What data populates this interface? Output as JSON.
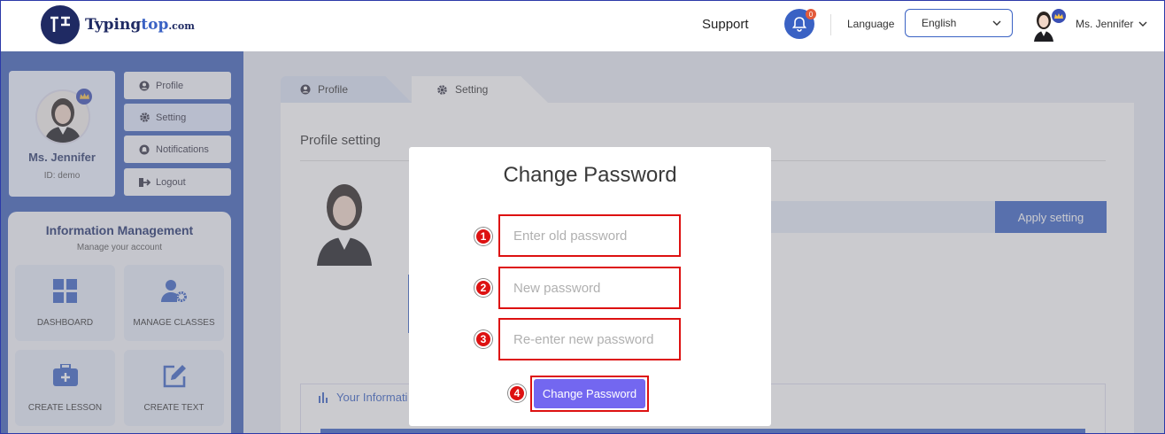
{
  "header": {
    "logo_main": "Typing",
    "logo_accent": "top",
    "logo_suffix": ".com",
    "support": "Support",
    "notification_count": "0",
    "language_label": "Language",
    "language_value": "English",
    "user_name": "Ms. Jennifer"
  },
  "sidebar": {
    "profile_name": "Ms. Jennifer",
    "profile_id": "ID: demo",
    "menu": [
      {
        "label": "Profile",
        "icon": "user-circle-icon"
      },
      {
        "label": "Setting",
        "icon": "gear-icon"
      },
      {
        "label": "Notifications",
        "icon": "bell-icon"
      },
      {
        "label": "Logout",
        "icon": "logout-icon"
      }
    ],
    "info_title": "Information Management",
    "info_subtitle": "Manage your account",
    "tiles": [
      {
        "label": "DASHBOARD",
        "icon": "grid-icon"
      },
      {
        "label": "MANAGE CLASSES",
        "icon": "user-gear-icon"
      },
      {
        "label": "CREATE LESSON",
        "icon": "briefcase-plus-icon"
      },
      {
        "label": "CREATE TEXT",
        "icon": "edit-icon"
      }
    ]
  },
  "main": {
    "tabs": [
      {
        "label": "Profile"
      },
      {
        "label": "Setting"
      }
    ],
    "section_title": "Profile setting",
    "apply_button": "Apply setting",
    "your_information": "Your Informati"
  },
  "modal": {
    "title": "Change Password",
    "fields": [
      {
        "marker": "1",
        "placeholder": "Enter old password"
      },
      {
        "marker": "2",
        "placeholder": "New password"
      },
      {
        "marker": "3",
        "placeholder": "Re-enter new password"
      }
    ],
    "button_marker": "4",
    "button_label": "Change Password"
  },
  "colors": {
    "brand_blue": "#3a62c4",
    "button_purple": "#7367f0",
    "annotation_red": "#dd1111"
  }
}
